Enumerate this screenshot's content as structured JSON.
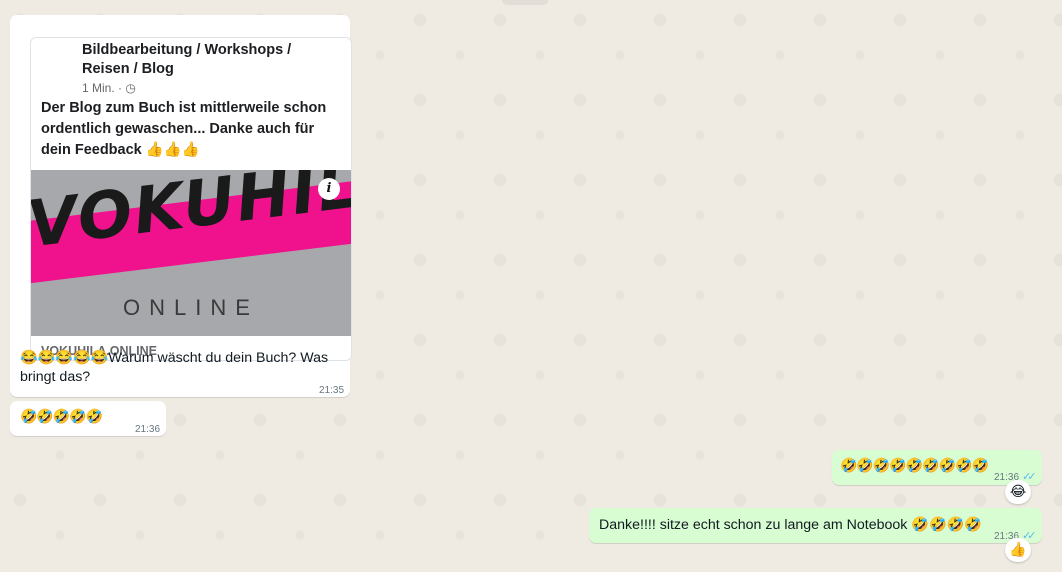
{
  "messages": {
    "m1": {
      "preview": {
        "title": "Bildbearbeitung / Workshops / Reisen / Blog",
        "meta": "1 Min. · ◷",
        "body": "Der Blog zum Buch ist mittlerweile schon ordentlich gewaschen... Danke auch für dein Feedback 👍👍👍",
        "image_logo": "VOKUHILA",
        "image_subtitle": "ONLINE",
        "info": "i",
        "domain": "VOKUHILA.ONLINE"
      },
      "text": "😂😂😂😂😂Warum wäscht du dein Buch? Was bringt das?",
      "time": "21:35"
    },
    "m2": {
      "text": "🤣🤣🤣🤣🤣",
      "time": "21:36"
    },
    "m3": {
      "text": "🤣🤣🤣🤣🤣🤣🤣🤣🤣",
      "time": "21:36",
      "reaction": "😂"
    },
    "m4": {
      "text": "Danke!!!! sitze echt schon zu lange am Notebook 🤣🤣🤣🤣",
      "time": "21:36",
      "reaction": "👍"
    }
  },
  "icons": {
    "read_receipt": "double-check-icon"
  },
  "colors": {
    "incoming": "#ffffff",
    "outgoing": "#d9fdd3",
    "background": "#efeae2",
    "ticks": "#53bdeb",
    "accent_stripe": "#f0128c"
  },
  "ticks_glyph": "✓✓"
}
